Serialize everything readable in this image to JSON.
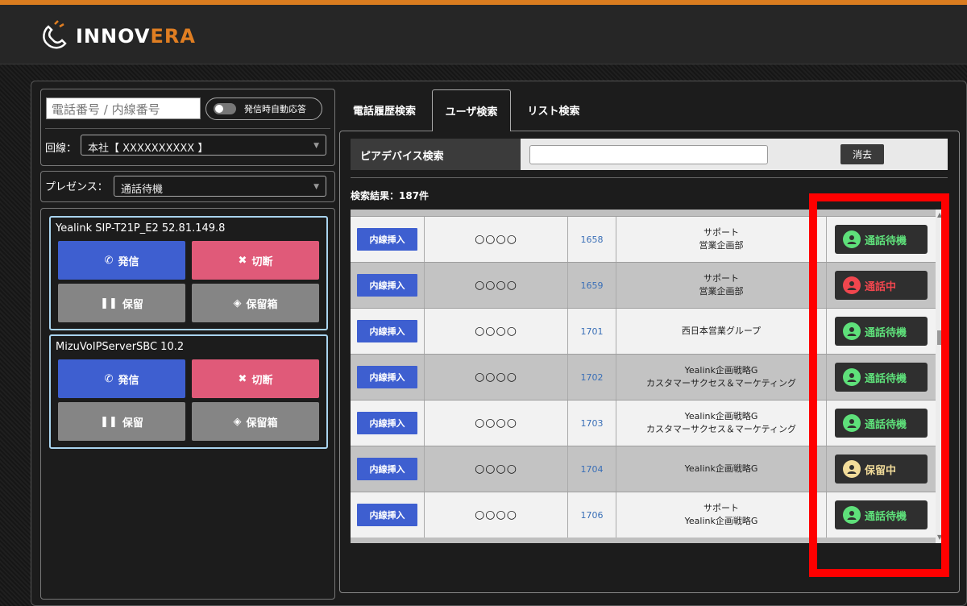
{
  "app": {
    "logo_text_main": "INNOV",
    "logo_text_accent": "ERA"
  },
  "left": {
    "phone_placeholder": "電話番号 / 内線番号",
    "auto_answer_label": "発信時自動応答",
    "line_label": "回線：",
    "line_value": "本社【 XXXXXXXXXX 】",
    "presence_label": "プレゼンス：",
    "presence_value": "通話待機",
    "devices": [
      {
        "title": "Yealink SIP-T21P_E2 52.81.149.8",
        "call": "発信",
        "hangup": "切断",
        "hold": "保留",
        "holdbox": "保留箱"
      },
      {
        "title": "MizuVoIPServerSBC 10.2",
        "call": "発信",
        "hangup": "切断",
        "hold": "保留",
        "holdbox": "保留箱"
      }
    ]
  },
  "tabs": [
    {
      "label": "電話履歴検索"
    },
    {
      "label": "ユーザ検索"
    },
    {
      "label": "リスト検索"
    }
  ],
  "search": {
    "label": "ピアデバイス検索",
    "clear_label": "消去",
    "result_count": "検索結果：187件"
  },
  "rows": [
    {
      "insert": "内線挿入",
      "name": "○○○○",
      "ext": "1658",
      "dept1": "サポート",
      "dept2": "営業企画部",
      "status": "通話待機",
      "status_type": "idle"
    },
    {
      "insert": "内線挿入",
      "name": "○○○○",
      "ext": "1659",
      "dept1": "サポート",
      "dept2": "営業企画部",
      "status": "通話中",
      "status_type": "busy"
    },
    {
      "insert": "内線挿入",
      "name": "○○○○",
      "ext": "1701",
      "dept1": "西日本営業グループ",
      "dept2": "",
      "status": "通話待機",
      "status_type": "idle"
    },
    {
      "insert": "内線挿入",
      "name": "○○○○",
      "ext": "1702",
      "dept1": "Yealink企画戦略G",
      "dept2": "カスタマーサクセス＆マーケティング",
      "status": "通話待機",
      "status_type": "idle"
    },
    {
      "insert": "内線挿入",
      "name": "○○○○",
      "ext": "1703",
      "dept1": "Yealink企画戦略G",
      "dept2": "カスタマーサクセス＆マーケティング",
      "status": "通話待機",
      "status_type": "idle"
    },
    {
      "insert": "内線挿入",
      "name": "○○○○",
      "ext": "1704",
      "dept1": "Yealink企画戦略G",
      "dept2": "",
      "status": "保留中",
      "status_type": "hold"
    },
    {
      "insert": "内線挿入",
      "name": "○○○○",
      "ext": "1706",
      "dept1": "サポート",
      "dept2": "Yealink企画戦略G",
      "status": "通話待機",
      "status_type": "idle"
    }
  ],
  "status_colors": {
    "idle": "#5ee07a",
    "busy": "#f0464e",
    "hold": "#f2dc9a"
  }
}
